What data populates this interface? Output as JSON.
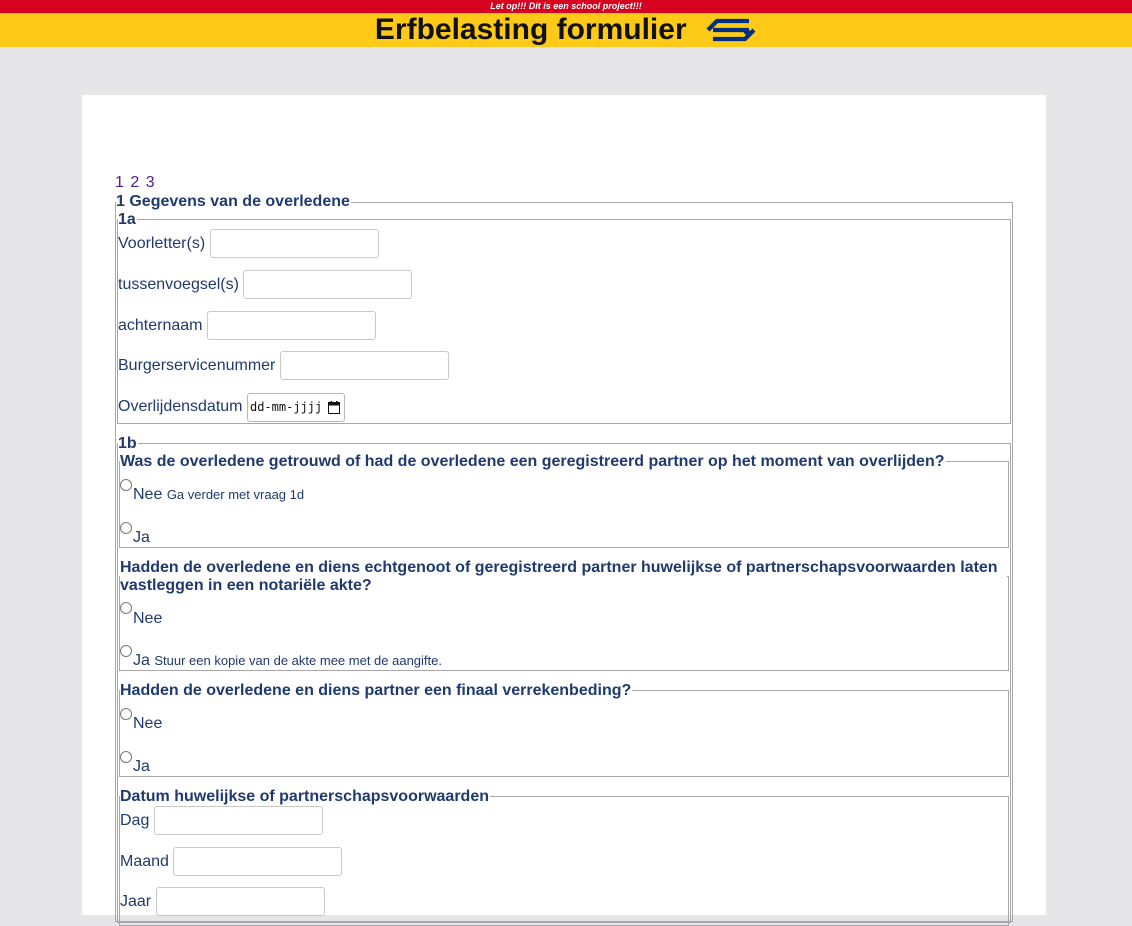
{
  "banner": {
    "warning": "Let op!!! Dit is een school project!!!",
    "title": "Erfbelasting formulier"
  },
  "steps": [
    "1",
    "2",
    "3"
  ],
  "section1": {
    "legend": "1 Gegevens van de overledene",
    "part_a": {
      "legend": "1a",
      "fields": [
        {
          "label": "Voorletter(s)",
          "value": ""
        },
        {
          "label": "tussenvoegsel(s)",
          "value": ""
        },
        {
          "label": "achternaam",
          "value": ""
        },
        {
          "label": "Burgerservicenummer",
          "value": ""
        },
        {
          "label": "Overlijdensdatum",
          "placeholder": "dd-mm-jjjj"
        }
      ]
    },
    "part_b": {
      "legend": "1b",
      "q1": {
        "legend": "Was de overledene getrouwd of had de overledene een geregistreerd partner op het moment van overlijden?",
        "opt_no": "Nee",
        "opt_no_hint": "Ga verder met vraag 1d",
        "opt_yes": "Ja"
      },
      "q2": {
        "legend": "Hadden de overledene en diens echtgenoot of geregistreerd partner huwelijkse of partnerschapsvoorwaarden laten vastleggen in een notariële akte?",
        "opt_no": "Nee",
        "opt_yes": "Ja",
        "opt_yes_hint": "Stuur een kopie van de akte mee met de aangifte."
      },
      "q3": {
        "legend": "Hadden de overledene en diens partner een finaal verrekenbeding?",
        "opt_no": "Nee",
        "opt_yes": "Ja"
      },
      "q4": {
        "legend": "Datum huwelijkse of partnerschapsvoorwaarden",
        "fields": [
          {
            "label": "Dag",
            "value": ""
          },
          {
            "label": "Maand",
            "value": ""
          },
          {
            "label": "Jaar",
            "value": ""
          }
        ]
      }
    }
  }
}
